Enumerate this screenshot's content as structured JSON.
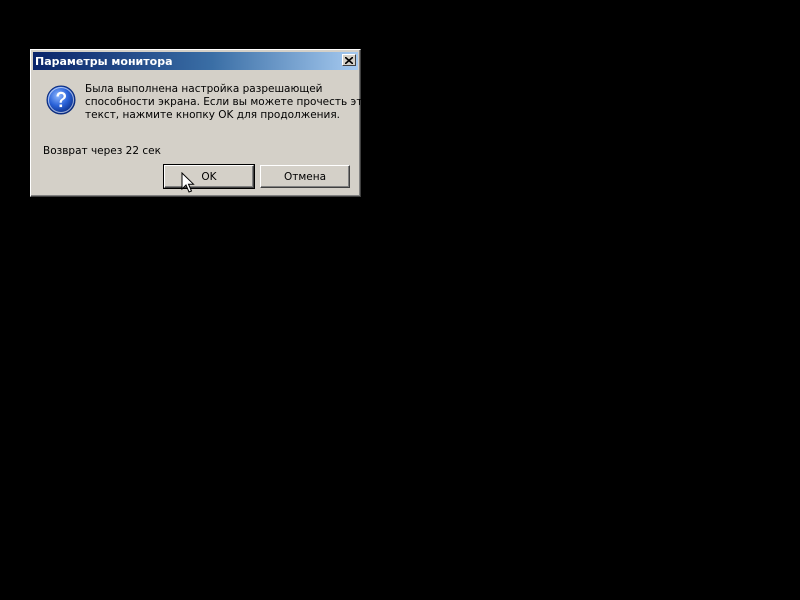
{
  "dialog": {
    "title": "Параметры монитора",
    "message_lines": [
      "Была выполнена настройка разрешающей",
      "способности экрана. Если вы можете прочесть этот",
      "текст, нажмите кнопку OK для продолжения."
    ],
    "countdown": "Возврат через 22 сек",
    "ok_label": "OK",
    "cancel_label": "Отмена",
    "icon": "question-icon",
    "close_icon": "close-icon"
  },
  "colors": {
    "desktop": "#000000",
    "dialog_face": "#d4d0c8",
    "titlebar_start": "#0a246a",
    "titlebar_end": "#a6caf0",
    "icon_blue": "#1c5bd6"
  }
}
